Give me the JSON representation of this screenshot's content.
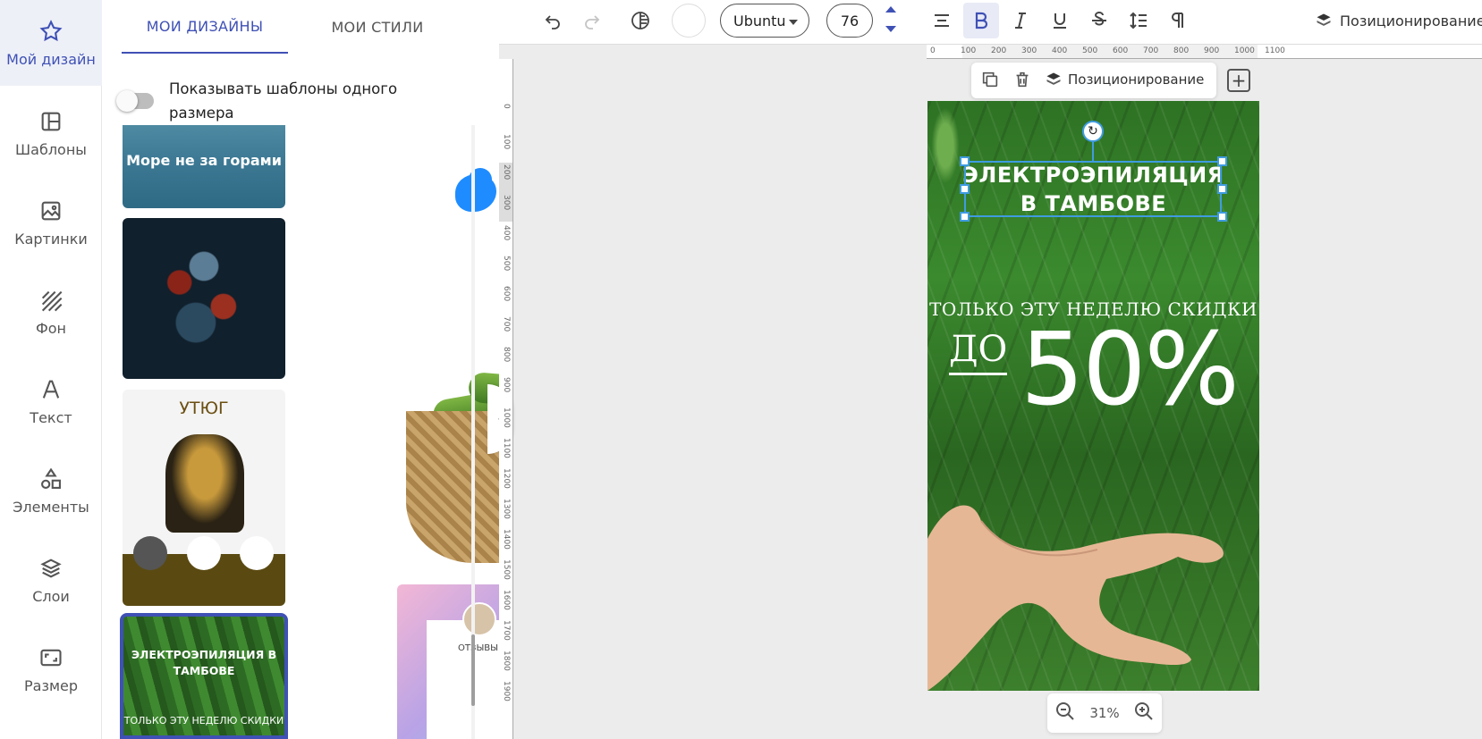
{
  "rail": {
    "items": [
      {
        "label": "Мой дизайн",
        "icon": "star-icon"
      },
      {
        "label": "Шаблоны",
        "icon": "template-icon"
      },
      {
        "label": "Картинки",
        "icon": "image-icon"
      },
      {
        "label": "Фон",
        "icon": "background-pattern-icon"
      },
      {
        "label": "Текст",
        "icon": "text-icon"
      },
      {
        "label": "Элементы",
        "icon": "shapes-icon"
      },
      {
        "label": "Слои",
        "icon": "layers-icon"
      },
      {
        "label": "Размер",
        "icon": "resize-icon"
      }
    ]
  },
  "panel": {
    "tabs": [
      "МОИ ДИЗАЙНЫ",
      "МОИ СТИЛИ"
    ],
    "toggle_label": "Показывать шаблоны одного размера",
    "thumbs": {
      "sea_text": "Море не за горами",
      "iron_text": "УТЮГ",
      "review_text": "ОТЗЫВЫ",
      "selected_title": "ЭЛЕКТРОЭПИЛЯЦИЯ В ТАМБОВЕ",
      "selected_sub": "ТОЛЬКО ЭТУ НЕДЕЛЮ СКИДКИ"
    }
  },
  "toolbar": {
    "font": "Ubuntu",
    "font_size": "76",
    "positioning": "Позиционирование"
  },
  "ruler": {
    "h_ticks": [
      "0",
      "100",
      "200",
      "300",
      "400",
      "500",
      "600",
      "700",
      "800",
      "900",
      "1000",
      "1100"
    ],
    "v_ticks": [
      "0",
      "100",
      "200",
      "300",
      "400",
      "500",
      "600",
      "700",
      "800",
      "900",
      "1000",
      "1100",
      "1200",
      "1300",
      "1400",
      "1500",
      "1600",
      "1700",
      "1800",
      "1900"
    ]
  },
  "element_bar": {
    "positioning": "Позиционирование"
  },
  "canvas": {
    "title_line1": "ЭЛЕКТРОЭПИЛЯЦИЯ",
    "title_line2": "В ТАМБОВЕ",
    "subtitle": "ТОЛЬКО ЭТУ НЕДЕЛЮ СКИДКИ",
    "do": "ДО",
    "percent": "50%"
  },
  "zoom": {
    "level": "31%"
  },
  "colors": {
    "accent": "#3f51b5",
    "selection": "#3f9be0"
  }
}
